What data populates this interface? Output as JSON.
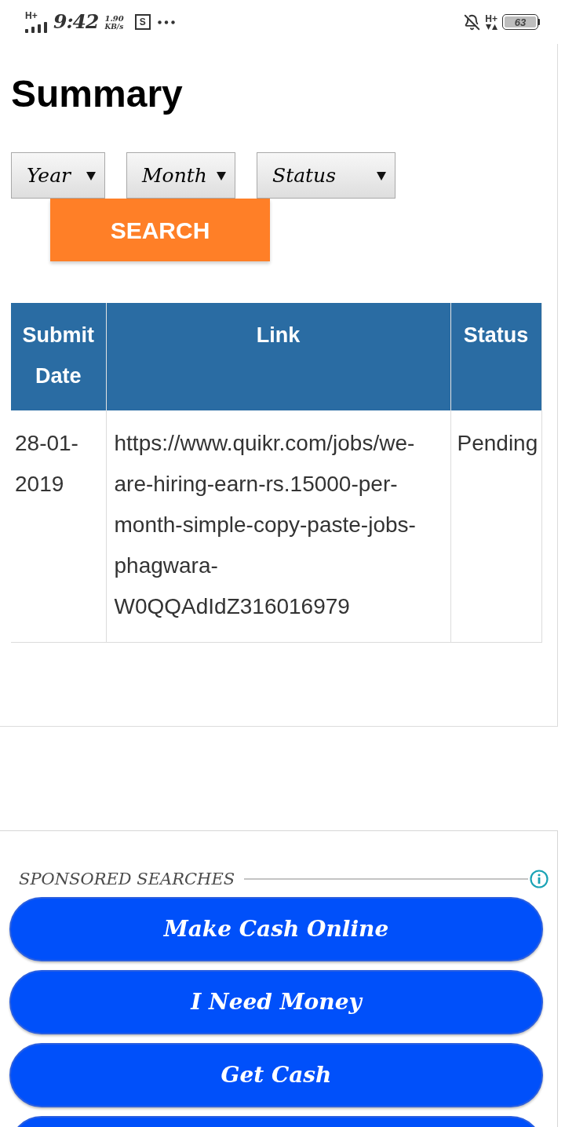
{
  "status_bar": {
    "left_network": "H+",
    "time": "9:42",
    "speed_value": "1.90",
    "speed_unit": "KB/s",
    "app_badge": "S",
    "right_network": "H+",
    "battery": "63"
  },
  "page": {
    "title": "Summary"
  },
  "filters": [
    {
      "label": "Year"
    },
    {
      "label": "Month"
    },
    {
      "label": "Status"
    }
  ],
  "search_button": "SEARCH",
  "table": {
    "columns": [
      "Submit Date",
      "Link",
      "Status"
    ],
    "rows": [
      [
        "28-01-2019",
        "https://www.quikr.com/jobs/we-are-hiring-earn-rs.15000-per-month-simple-copy-paste-jobs-phagwara-W0QQAdIdZ316016979",
        "Pending"
      ]
    ]
  },
  "sponsored": {
    "heading": "SPONSORED SEARCHES",
    "buttons": [
      {
        "label": "Make Cash Online"
      },
      {
        "label": "I Need Money"
      },
      {
        "label": "Get Cash"
      }
    ],
    "more_below": true
  }
}
